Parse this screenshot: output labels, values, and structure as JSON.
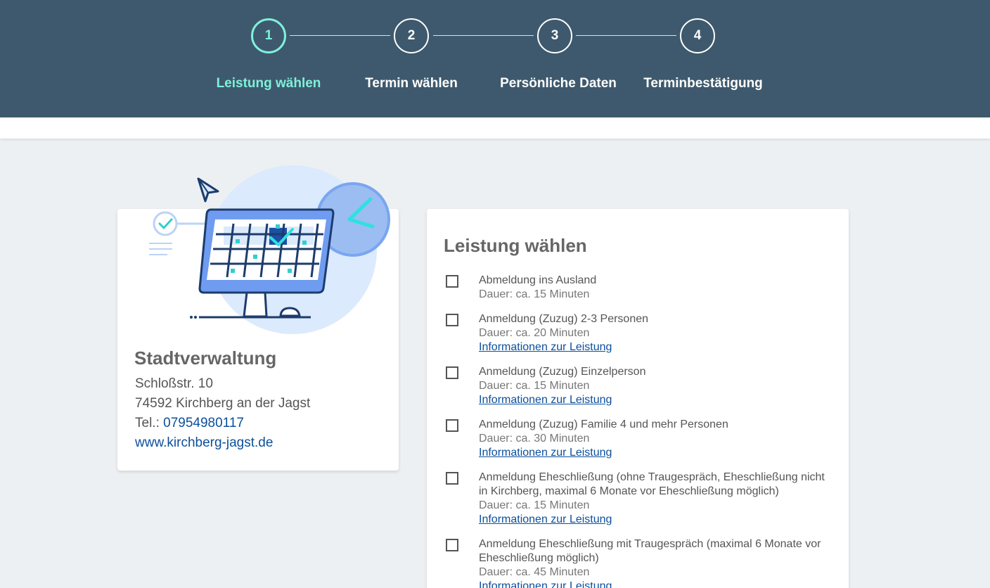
{
  "stepper": {
    "steps": [
      {
        "number": "1",
        "label": "Leistung wählen",
        "active": true
      },
      {
        "number": "2",
        "label": "Termin wählen",
        "active": false
      },
      {
        "number": "3",
        "label": "Persönliche Daten",
        "active": false
      },
      {
        "number": "4",
        "label": "Terminbestätigung",
        "active": false
      }
    ],
    "colors": {
      "bar": "#3e596d",
      "active": "#7ff0db",
      "inactive": "#ffffff"
    }
  },
  "office": {
    "name": "Stadtverwaltung",
    "street": "Schloßstr. 10",
    "city": "74592 Kirchberg an der Jagst",
    "phone_label": "Tel.:",
    "phone": "07954980117",
    "website": "www.kirchberg-jagst.de"
  },
  "services": {
    "title": "Leistung wählen",
    "items": [
      {
        "name": "Abmeldung ins Ausland",
        "duration": "Dauer: ca. 15 Minuten",
        "info": "",
        "checked": false
      },
      {
        "name": "Anmeldung (Zuzug) 2-3 Personen",
        "duration": "Dauer: ca. 20 Minuten",
        "info": "Informationen zur Leistung",
        "checked": false
      },
      {
        "name": "Anmeldung (Zuzug) Einzelperson",
        "duration": "Dauer: ca. 15 Minuten",
        "info": "Informationen zur Leistung",
        "checked": false
      },
      {
        "name": "Anmeldung (Zuzug) Familie 4 und mehr Personen",
        "duration": "Dauer: ca. 30 Minuten",
        "info": "Informationen zur Leistung",
        "checked": false
      },
      {
        "name": "Anmeldung Eheschließung (ohne Traugespräch, Eheschließung nicht in Kirchberg, maximal 6 Monate vor Eheschließung möglich)",
        "duration": "Dauer: ca. 15 Minuten",
        "info": "Informationen zur Leistung",
        "checked": false
      },
      {
        "name": "Anmeldung Eheschließung mit Traugespräch (maximal 6 Monate vor Eheschließung möglich)",
        "duration": "Dauer: ca. 45 Minuten",
        "info": "Informationen zur Leistung",
        "checked": false
      }
    ]
  }
}
